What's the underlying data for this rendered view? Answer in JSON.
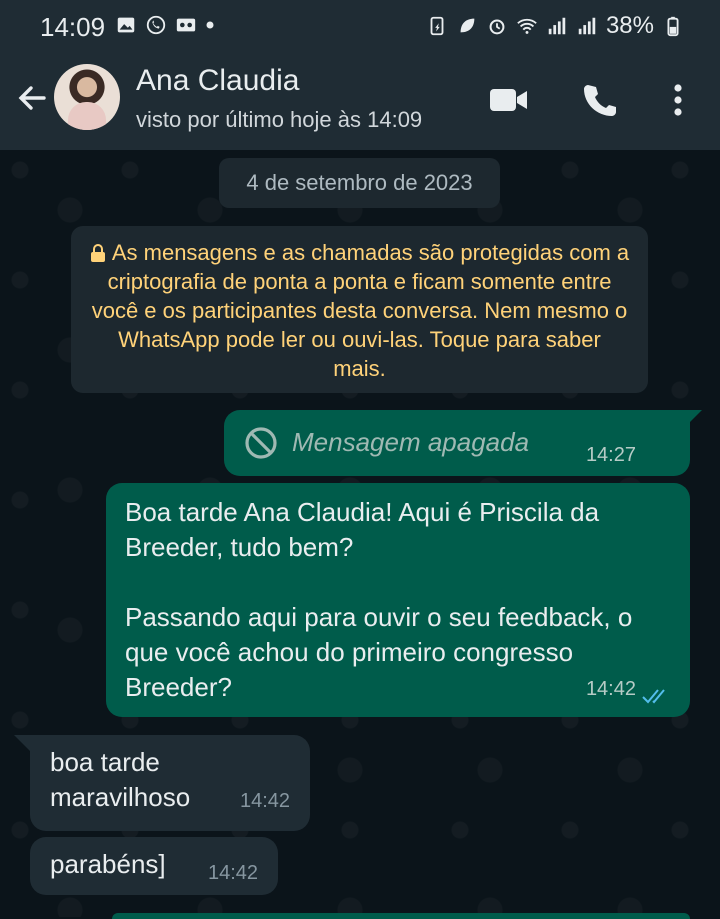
{
  "status_bar": {
    "time": "14:09",
    "battery": "38%"
  },
  "header": {
    "contact_name": "Ana Claudia",
    "last_seen": "visto por último hoje às 14:09"
  },
  "chat": {
    "date_chip": "4 de setembro de 2023",
    "encryption_notice": "As mensagens e as chamadas são protegidas com a criptografia de ponta a ponta e ficam somente entre você e os participantes desta conversa. Nem mesmo o WhatsApp pode ler ou ouvi-las. Toque para saber mais.",
    "messages": [
      {
        "direction": "out",
        "deleted": true,
        "text": "Mensagem apagada",
        "time": "14:27"
      },
      {
        "direction": "out",
        "paragraphs": [
          "Boa tarde Ana Claudia! Aqui é Priscila da Breeder, tudo bem?",
          "Passando aqui para ouvir o seu feedback, o que você achou do primeiro congresso Breeder?"
        ],
        "time": "14:42",
        "status": "read"
      },
      {
        "direction": "in",
        "lines": [
          "boa tarde",
          "maravilhoso"
        ],
        "time": "14:42"
      },
      {
        "direction": "in",
        "text": "parabéns]",
        "time": "14:42"
      }
    ]
  },
  "colors": {
    "header_bg": "#1f2c34",
    "chat_bg": "#0b141a",
    "outgoing_bubble": "#005c4b",
    "incoming_bubble": "#1f2c34",
    "notice_text": "#ffd279",
    "read_ticks": "#53bdeb"
  },
  "icons": [
    "back-arrow-icon",
    "video-call-icon",
    "voice-call-icon",
    "more-options-icon",
    "lock-icon",
    "deleted-ban-icon",
    "double-check-icon"
  ]
}
